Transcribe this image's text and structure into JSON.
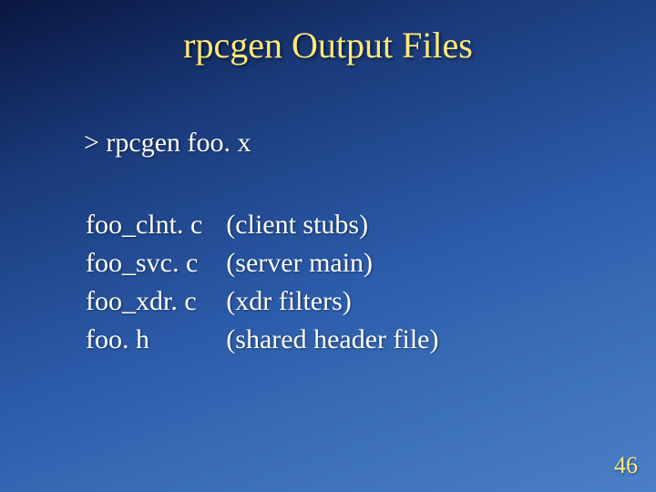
{
  "title": "rpcgen Output Files",
  "command": "> rpcgen foo. x",
  "files": {
    "row0": {
      "name": "foo_clnt. c",
      "desc": "(client stubs)"
    },
    "row1": {
      "name": "foo_svc. c",
      "desc": " (server main)"
    },
    "row2": {
      "name": "foo_xdr. c",
      "desc": " (xdr  filters)"
    },
    "row3": {
      "name": "foo. h",
      "desc": " (shared header file)"
    }
  },
  "page_number": "46"
}
